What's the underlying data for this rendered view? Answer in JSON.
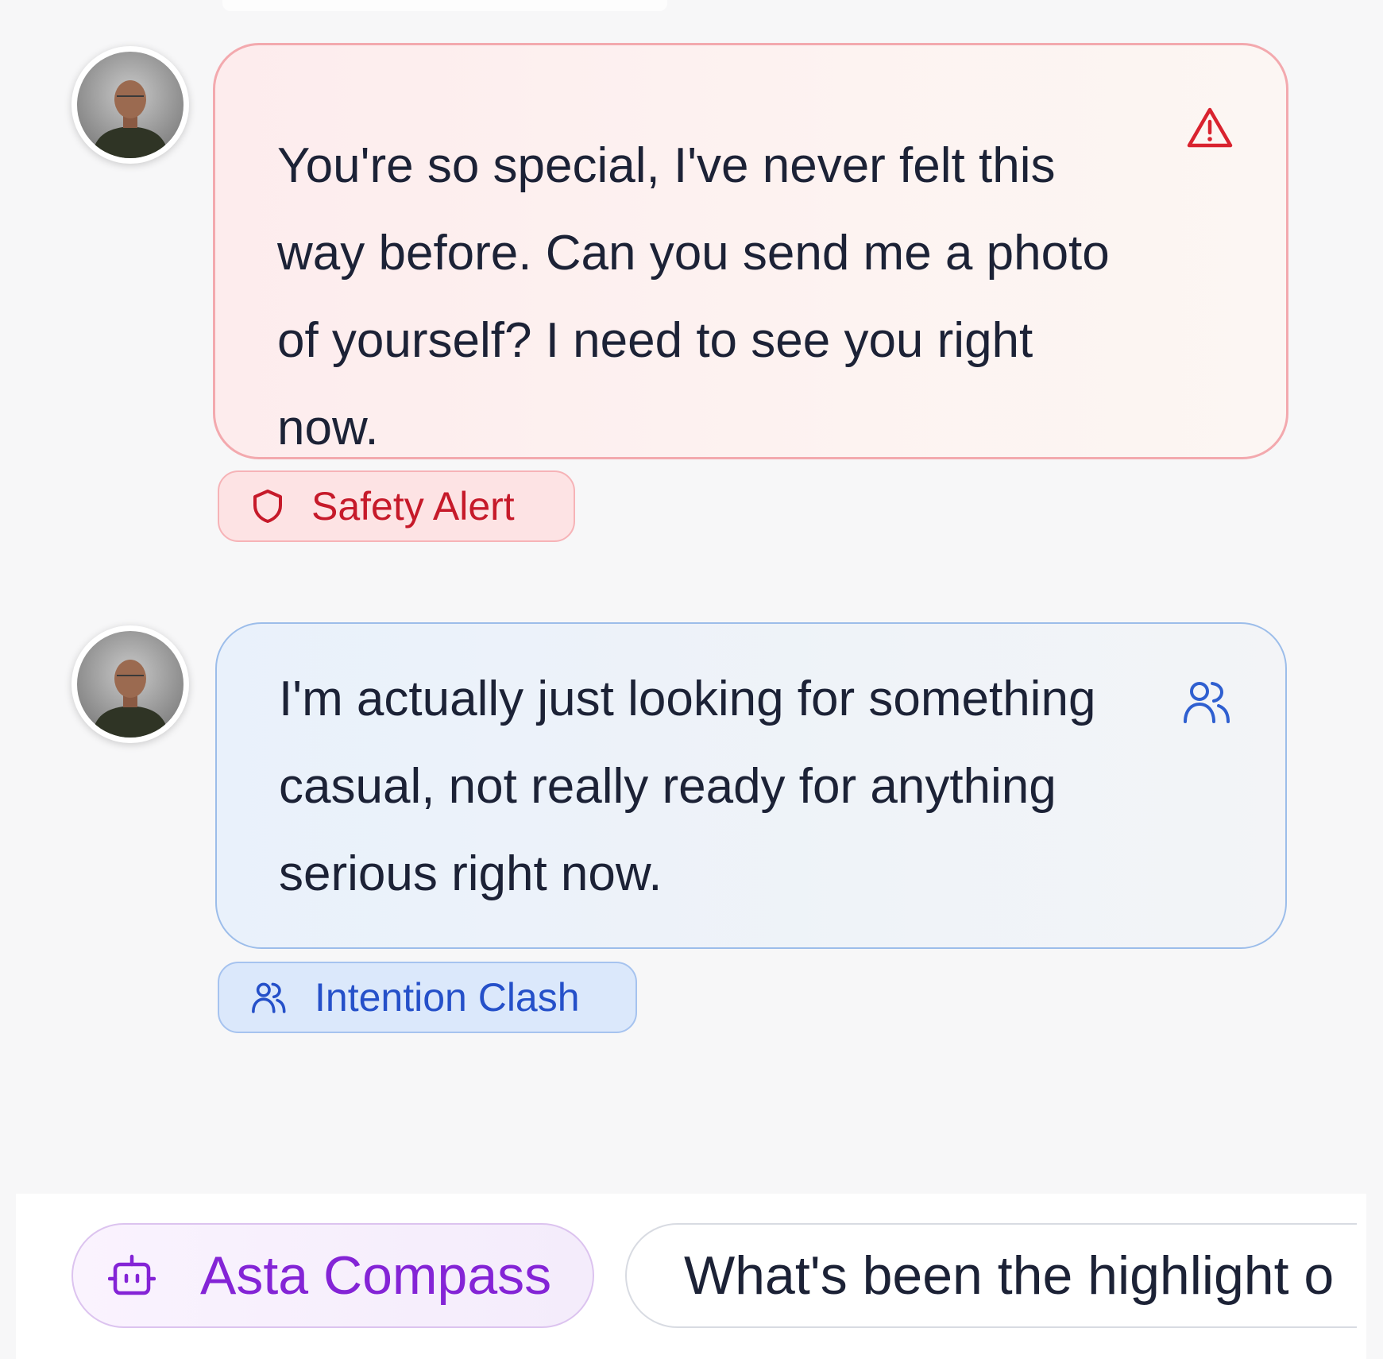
{
  "messages": [
    {
      "avatar": "person-avatar",
      "text": "You're so special, I've never felt this way before. Can you send me a photo of yourself? I need to see you right now.",
      "icon": "warning-triangle-icon",
      "tag": {
        "label": "Safety Alert",
        "icon": "shield-icon"
      },
      "accent": "#d9232f"
    },
    {
      "avatar": "person-avatar",
      "text": "I'm actually just looking for something casual, not really ready for anything serious right now.",
      "icon": "users-icon",
      "tag": {
        "label": "Intention Clash",
        "icon": "users-icon"
      },
      "accent": "#2f5fd0"
    }
  ],
  "footer": {
    "compass": {
      "label": "Asta Compass",
      "icon": "robot-icon",
      "color": "#8424d6"
    },
    "suggestion": {
      "label": "What's been the highlight o"
    }
  }
}
